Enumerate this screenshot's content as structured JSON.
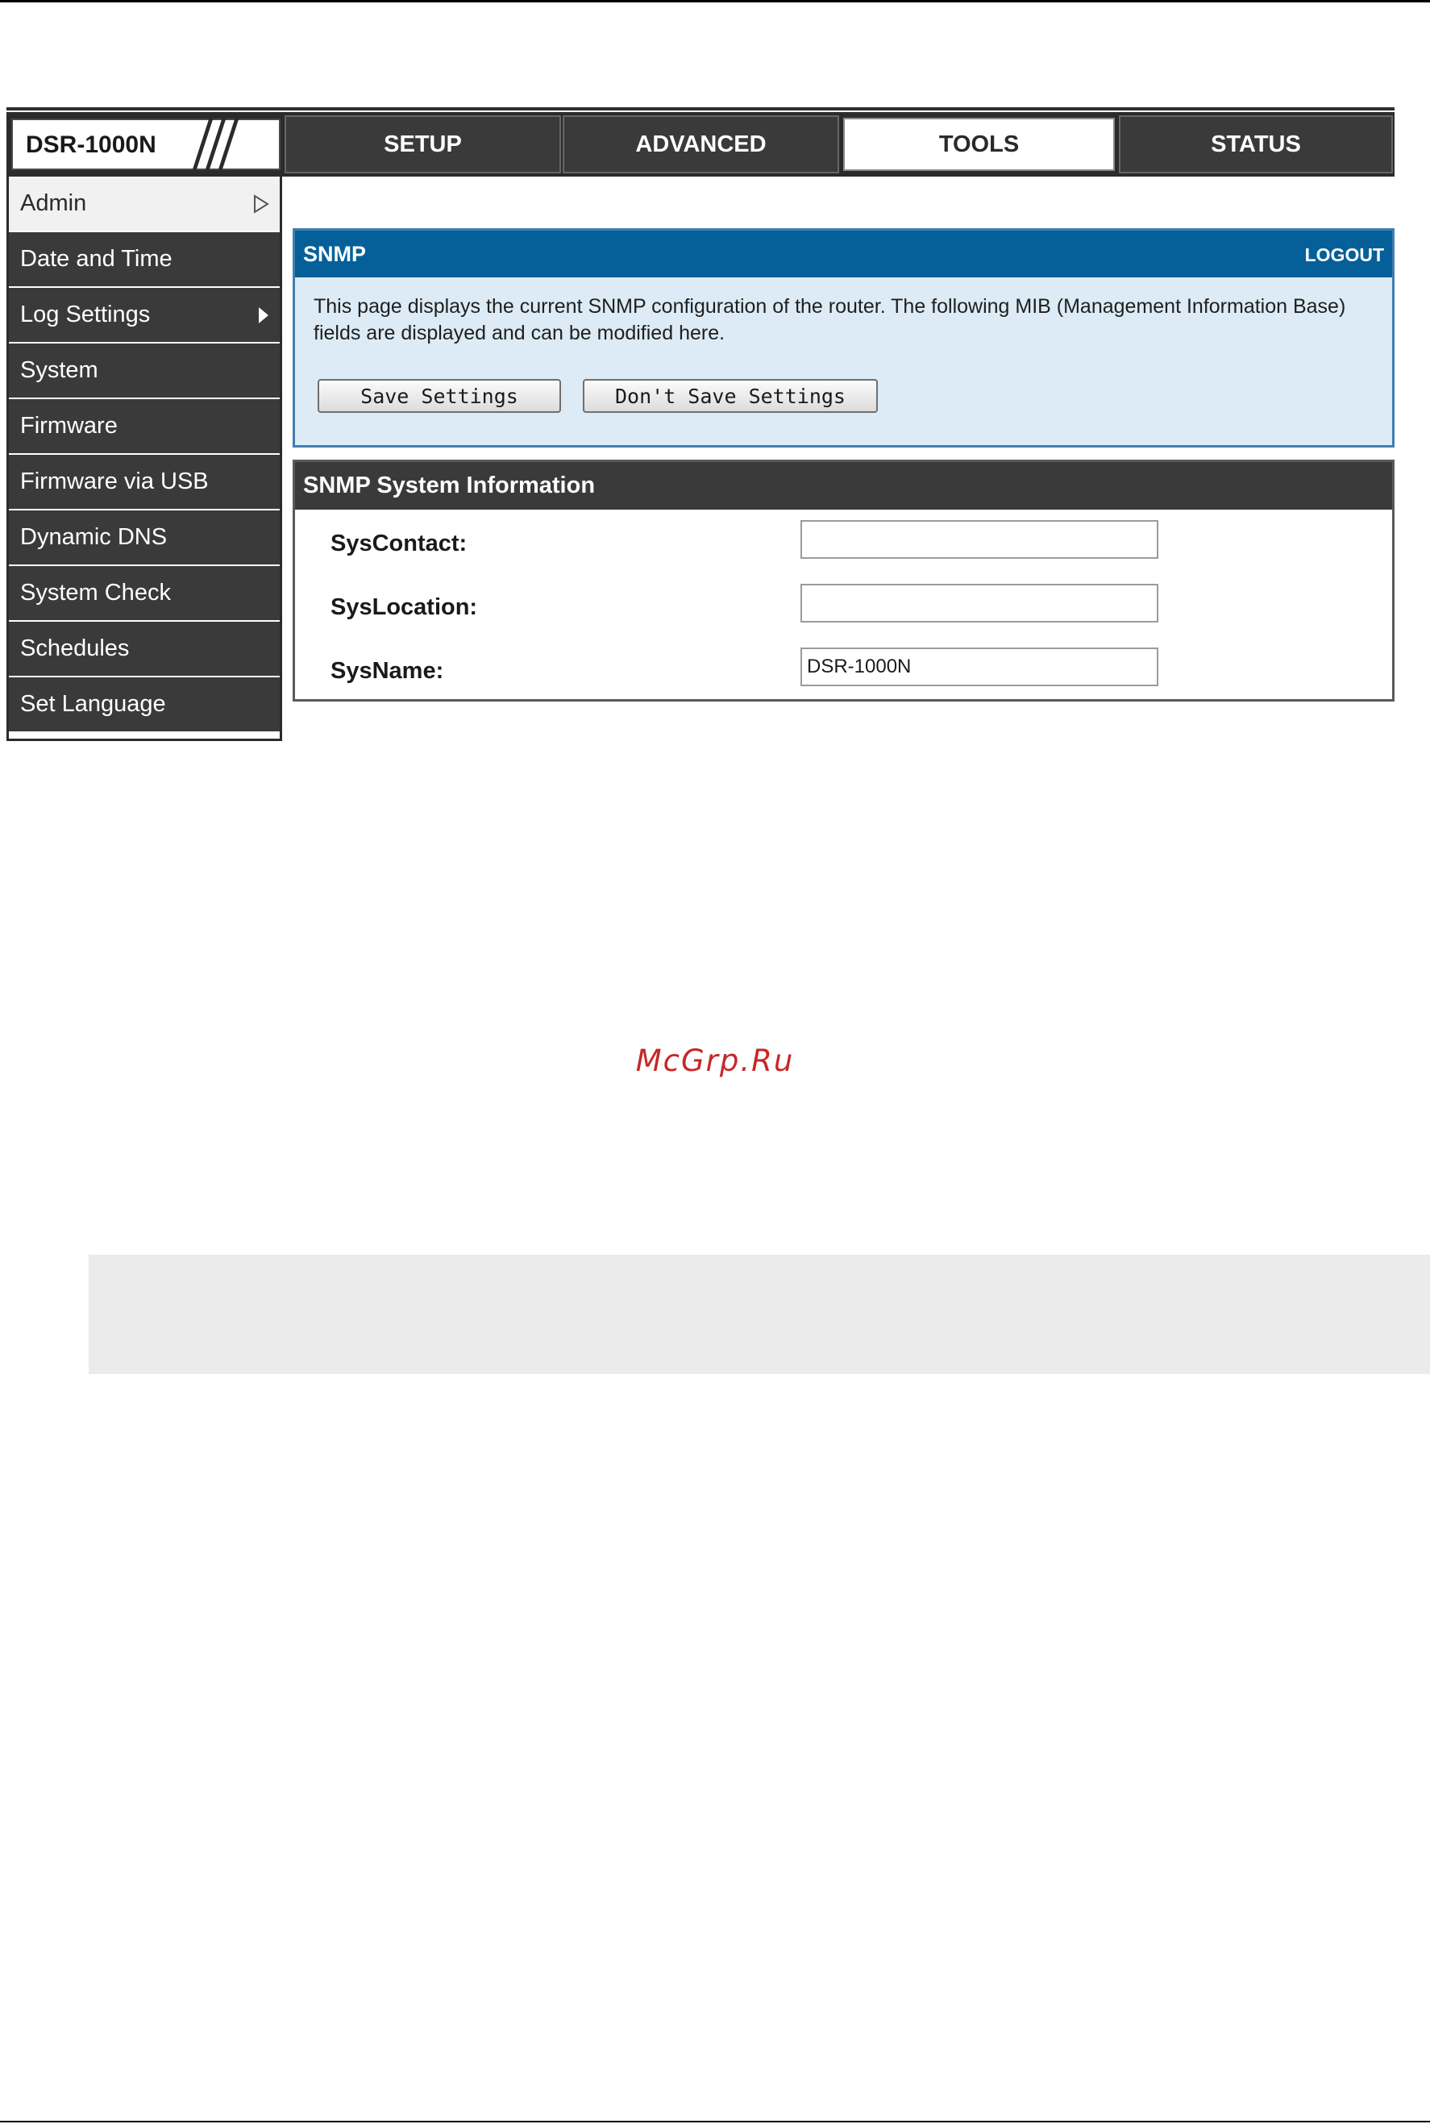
{
  "app": {
    "model": "DSR-1000N"
  },
  "nav": {
    "tabs": [
      {
        "label": "SETUP"
      },
      {
        "label": "ADVANCED"
      },
      {
        "label": "TOOLS",
        "active": true
      },
      {
        "label": "STATUS"
      }
    ]
  },
  "sidebar": {
    "items": [
      {
        "label": "Admin",
        "selected": true,
        "icon": "chevron-right-outline-icon"
      },
      {
        "label": "Date and Time"
      },
      {
        "label": "Log Settings",
        "icon": "caret-right-icon"
      },
      {
        "label": "System"
      },
      {
        "label": "Firmware"
      },
      {
        "label": "Firmware via USB"
      },
      {
        "label": "Dynamic DNS"
      },
      {
        "label": "System Check"
      },
      {
        "label": "Schedules"
      },
      {
        "label": "Set Language"
      }
    ]
  },
  "snmp_panel": {
    "title": "SNMP",
    "logout_label": "LOGOUT",
    "description": "This page displays the current SNMP configuration of the router. The following MIB (Management Information Base) fields are displayed and can be modified here.",
    "save_label": "Save Settings",
    "dont_save_label": "Don't Save Settings"
  },
  "system_info": {
    "title": "SNMP System Information",
    "fields": [
      {
        "label": "SysContact:",
        "value": ""
      },
      {
        "label": "SysLocation:",
        "value": ""
      },
      {
        "label": "SysName:",
        "value": "DSR-1000N"
      }
    ]
  },
  "watermark": "McGrp.Ru",
  "colors": {
    "header_bg": "#2b2b2b",
    "panel_header_blue": "#056099",
    "panel_body_blue": "#dcebf5",
    "watermark_red": "#c62828"
  }
}
